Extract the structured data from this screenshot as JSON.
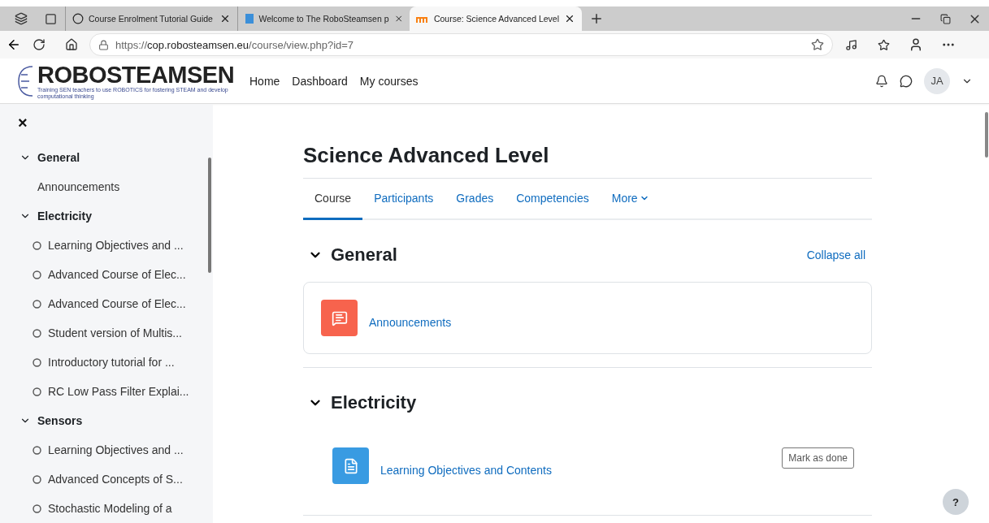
{
  "browser": {
    "tabs": [
      {
        "title": "Course Enrolment Tutorial Guide",
        "selected": false
      },
      {
        "title": "Welcome to The RoboSteamsen p",
        "selected": false
      },
      {
        "title": "Course: Science Advanced Level",
        "selected": true
      }
    ],
    "url": {
      "prefix": "https://",
      "domain": "cop.robosteamsen.eu",
      "path": "/course/view.php?id=7"
    }
  },
  "site": {
    "logo": "ROBOSTEAMSEN",
    "tagline": "Training SEN teachers to use ROBOTICS for fostering STEAM and develop computational thinking",
    "nav": [
      "Home",
      "Dashboard",
      "My courses"
    ],
    "user_initials": "JA"
  },
  "sidebar": {
    "close": "×",
    "sections": [
      {
        "title": "General",
        "expanded": true,
        "children": [
          {
            "label": "Announcements",
            "kind": "plain"
          }
        ]
      },
      {
        "title": "Electricity",
        "expanded": true,
        "children": [
          {
            "label": "Learning Objectives and ...",
            "kind": "activity",
            "completed": false
          },
          {
            "label": "Advanced Course of Elec...",
            "kind": "activity",
            "completed": false
          },
          {
            "label": "Advanced Course of Elec...",
            "kind": "activity",
            "completed": false
          },
          {
            "label": "Student version of Multis...",
            "kind": "activity",
            "completed": false
          },
          {
            "label": "Introductory tutorial for ...",
            "kind": "activity",
            "completed": false
          },
          {
            "label": "RC Low Pass Filter Explai...",
            "kind": "activity",
            "completed": false
          }
        ]
      },
      {
        "title": "Sensors",
        "expanded": true,
        "children": [
          {
            "label": "Learning Objectives and ...",
            "kind": "activity",
            "completed": false
          },
          {
            "label": "Advanced Concepts of S...",
            "kind": "activity",
            "completed": false
          },
          {
            "label": "Stochastic Modeling of a",
            "kind": "activity",
            "completed": false
          }
        ]
      }
    ]
  },
  "course": {
    "title": "Science Advanced Level",
    "tabs": [
      {
        "label": "Course",
        "selected": true
      },
      {
        "label": "Participants",
        "selected": false
      },
      {
        "label": "Grades",
        "selected": false
      },
      {
        "label": "Competencies",
        "selected": false
      },
      {
        "label": "More",
        "selected": false
      }
    ],
    "collapse_all": "Collapse all",
    "sections": [
      {
        "title": "General",
        "expanded": true,
        "carded": true,
        "activities": [
          {
            "name": "Announcements",
            "kind": "forum"
          }
        ]
      },
      {
        "title": "Electricity",
        "expanded": true,
        "carded": false,
        "activities": [
          {
            "name": "Learning Objectives and Contents",
            "kind": "page",
            "button": "Mark as done"
          }
        ]
      }
    ]
  },
  "help": "?"
}
